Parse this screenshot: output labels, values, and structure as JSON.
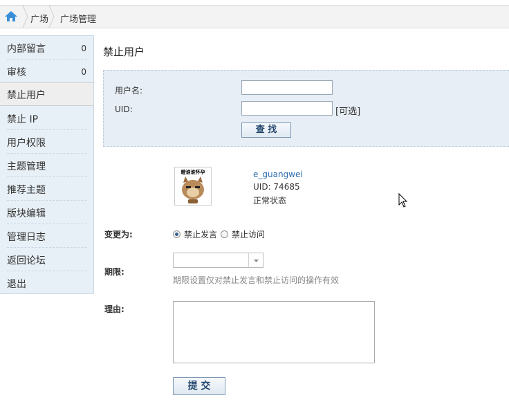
{
  "breadcrumb": {
    "items": [
      "广场",
      "广场管理"
    ]
  },
  "sidebar": {
    "items": [
      {
        "label": "内部留言",
        "count": "0"
      },
      {
        "label": "审核",
        "count": "0"
      },
      {
        "label": "禁止用户"
      },
      {
        "label": "禁止 IP"
      },
      {
        "label": "用户权限"
      },
      {
        "label": "主题管理"
      },
      {
        "label": "推荐主题"
      },
      {
        "label": "版块编辑"
      },
      {
        "label": "管理日志"
      },
      {
        "label": "返回论坛"
      },
      {
        "label": "退出"
      }
    ]
  },
  "page": {
    "title": "禁止用户"
  },
  "search": {
    "username_label": "用户名:",
    "username_value": "",
    "uid_label": "UID:",
    "uid_value": "",
    "uid_hint": "[可选]",
    "search_button": "查 找"
  },
  "user": {
    "name": "e_guangwei",
    "uid": "UID: 74685",
    "status": "正常状态",
    "avatar_caption": "瞪谁谁怀孕"
  },
  "form": {
    "change_label": "变更为:",
    "option_ban_post": "禁止发言",
    "option_ban_visit": "禁止访问",
    "selected_option": "禁止发言",
    "period_label": "期限:",
    "period_value": "",
    "period_note": "期限设置仅对禁止发言和禁止访问的操作有效",
    "reason_label": "理由:",
    "reason_value": "",
    "submit_button": "提 交"
  }
}
